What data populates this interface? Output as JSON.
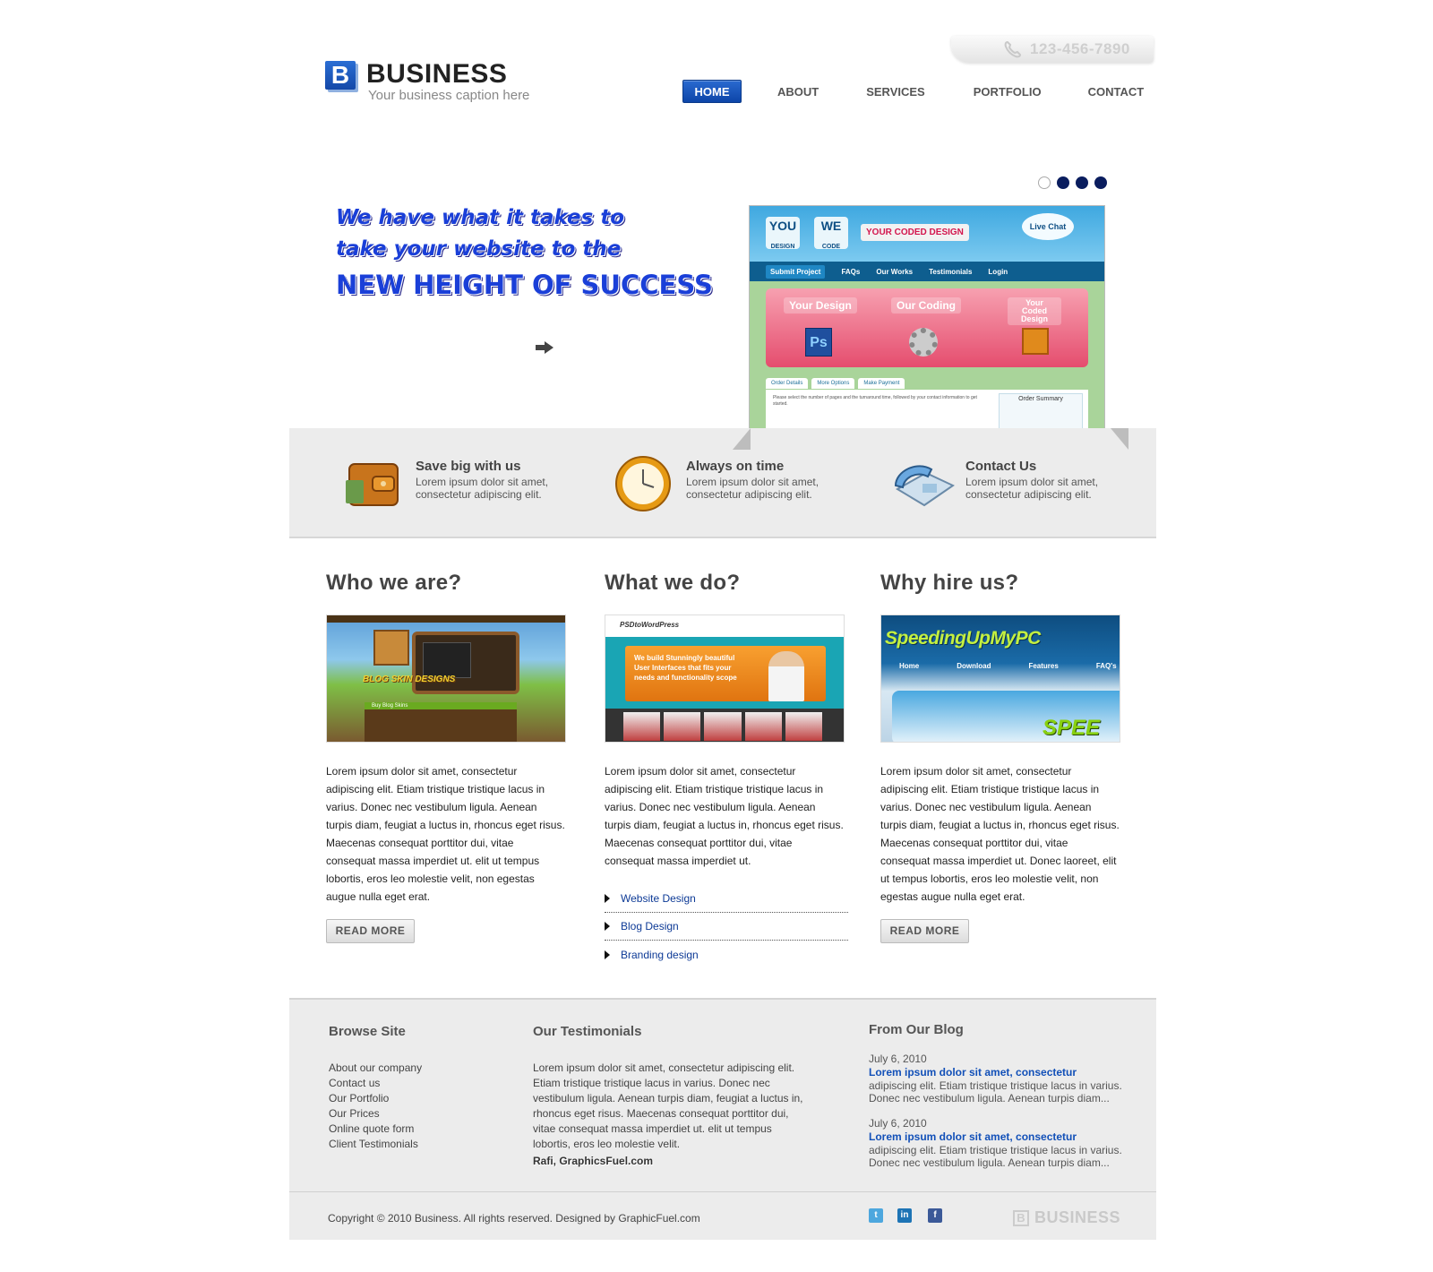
{
  "header": {
    "phone": "123-456-7890",
    "logo_mark": "B",
    "logo_title": "BUSINESS",
    "logo_caption": "Your business caption here"
  },
  "nav": {
    "home": "HOME",
    "about": "ABOUT",
    "services": "SERVICES",
    "portfolio": "PORTFOLIO",
    "contact": "CONTACT"
  },
  "hero": {
    "line1": "We have what it takes to",
    "line2": "take your website to the",
    "line3": "NEW HEIGHT OF SUCCESS",
    "slider_active_index": 1,
    "slider_count": 4,
    "shot": {
      "you": "YOU",
      "you_sub": "DESIGN",
      "we": "WE",
      "we_sub": "CODE",
      "coded": "YOUR CODED DESIGN",
      "chat": "Live Chat",
      "nav": [
        "Submit Project",
        "FAQs",
        "Our Works",
        "Testimonials",
        "Login"
      ],
      "step1": "Your Design",
      "step2": "Our Coding",
      "step3": "Your Coded Design",
      "ps": "Ps",
      "tabs": [
        "Order Details",
        "More Options",
        "Make Payment"
      ],
      "form_text": "Please select the number of pages and the turnaround time, followed by your contact information to get started.",
      "summary": "Order Summary"
    }
  },
  "features": [
    {
      "title": "Save big with us",
      "text": "Lorem ipsum dolor sit amet, consectetur adipiscing elit.",
      "icon": "wallet-icon"
    },
    {
      "title": "Always on time",
      "text": "Lorem ipsum dolor sit amet, consectetur adipiscing elit.",
      "icon": "clock-icon"
    },
    {
      "title": "Contact Us",
      "text": "Lorem ipsum dolor sit amet, consectetur adipiscing elit.",
      "icon": "telephone-icon"
    }
  ],
  "columns": {
    "who": {
      "title": "Who we are?",
      "text": "Lorem ipsum dolor sit amet, consectetur adipiscing elit. Etiam tristique tristique lacus in varius. Donec nec vestibulum ligula. Aenean turpis diam, feugiat a luctus in, rhoncus eget risus. Maecenas consequat porttitor dui, vitae consequat massa imperdiet ut. elit ut tempus lobortis, eros leo molestie velit, non egestas augue nulla eget erat.",
      "button": "READ MORE",
      "thumb_sign": "BLOG SKIN DESIGNS",
      "thumb_strip": "Buy Blog Skins"
    },
    "what": {
      "title": "What we do?",
      "text": "Lorem ipsum dolor sit amet, consectetur adipiscing elit. Etiam tristique tristique lacus in varius. Donec nec vestibulum ligula. Aenean turpis diam, feugiat a luctus in, rhoncus eget risus. Maecenas consequat porttitor dui, vitae consequat massa imperdiet ut.",
      "services": [
        "Website Design",
        "Blog Design",
        "Branding design"
      ],
      "thumb_logo": "PSDtoWordPress",
      "thumb_text": "We build Stunningly beautiful User Interfaces that fits your needs and functionality scope"
    },
    "why": {
      "title": "Why hire us?",
      "text": "Lorem ipsum dolor sit amet, consectetur adipiscing elit. Etiam tristique tristique lacus in varius. Donec nec vestibulum ligula. Aenean turpis diam, feugiat a luctus in, rhoncus eget risus. Maecenas consequat porttitor dui, vitae consequat massa imperdiet ut. Donec laoreet, elit ut tempus lobortis, eros leo molestie velit, non egestas augue nulla eget erat.",
      "button": "READ MORE",
      "thumb_brand": "SpeedingUpMyPC",
      "thumb_nav": [
        "Home",
        "Download",
        "Features",
        "FAQ's"
      ],
      "thumb_speed": "SPEE"
    }
  },
  "footer": {
    "browse_title": "Browse Site",
    "browse_links": [
      "About our company",
      "Contact us",
      "Our Portfolio",
      "Our Prices",
      "Online quote form",
      "Client Testimonials"
    ],
    "testimonials_title": "Our Testimonials",
    "testimonial_text": "Lorem ipsum dolor sit amet, consectetur adipiscing elit. Etiam tristique tristique lacus in varius. Donec nec vestibulum ligula. Aenean turpis diam, feugiat a luctus in, rhoncus eget risus. Maecenas consequat porttitor dui, vitae consequat massa imperdiet ut. elit ut tempus lobortis, eros leo molestie velit.",
    "testimonial_author": "Rafi, GraphicsFuel.com",
    "blog_title": "From Our Blog",
    "blog_posts": [
      {
        "date": "July 6, 2010",
        "title": "Lorem ipsum dolor sit amet, consectetur",
        "excerpt": "adipiscing elit. Etiam tristique tristique lacus in varius. Donec nec vestibulum ligula. Aenean turpis diam..."
      },
      {
        "date": "July 6, 2010",
        "title": "Lorem ipsum dolor sit amet, consectetur",
        "excerpt": "adipiscing elit. Etiam tristique tristique lacus in varius. Donec nec vestibulum ligula. Aenean turpis diam..."
      }
    ],
    "copyright": "Copyright © 2010 Business. All rights reserved. Designed by GraphicFuel.com",
    "social": [
      "twitter-icon",
      "linkedin-icon",
      "facebook-icon"
    ],
    "social_glyphs": [
      "t",
      "in",
      "f"
    ],
    "logo_mark": "B",
    "logo_text": "BUSINESS"
  },
  "colors": {
    "accent": "#1448a8",
    "link": "#1250b8",
    "band": "#ececec",
    "hero_text": "#1a3fd8"
  }
}
